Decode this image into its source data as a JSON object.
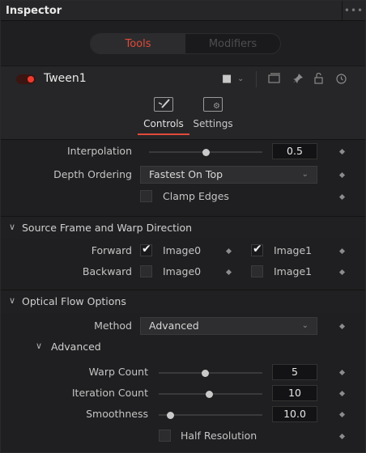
{
  "window": {
    "title": "Inspector",
    "menu_icon": "ellipsis-icon"
  },
  "segmented": {
    "tools": "Tools",
    "modifiers": "Modifiers",
    "selected": "Tools"
  },
  "node": {
    "name": "Tween1",
    "enabled": true
  },
  "tabs": [
    {
      "label": "Controls",
      "active": true
    },
    {
      "label": "Settings",
      "active": false
    }
  ],
  "controls": {
    "interpolation": {
      "label": "Interpolation",
      "value": "0.5",
      "fraction": 0.5
    },
    "depth_ordering": {
      "label": "Depth Ordering",
      "value": "Fastest On Top"
    },
    "clamp_edges": {
      "label": "Clamp Edges",
      "checked": false
    }
  },
  "source_frame": {
    "title": "Source Frame and Warp Direction",
    "forward": {
      "label": "Forward",
      "image0": {
        "label": "Image0",
        "checked": true
      },
      "image1": {
        "label": "Image1",
        "checked": true
      }
    },
    "backward": {
      "label": "Backward",
      "image0": {
        "label": "Image0",
        "checked": false
      },
      "image1": {
        "label": "Image1",
        "checked": false
      }
    }
  },
  "optical_flow": {
    "title": "Optical Flow Options",
    "method": {
      "label": "Method",
      "value": "Advanced"
    },
    "advanced": {
      "title": "Advanced",
      "warp_count": {
        "label": "Warp Count",
        "value": "5",
        "fraction": 0.45
      },
      "iteration_count": {
        "label": "Iteration Count",
        "value": "10",
        "fraction": 0.5
      },
      "smoothness": {
        "label": "Smoothness",
        "value": "10.0",
        "fraction": 0.08
      },
      "half_resolution": {
        "label": "Half Resolution",
        "checked": false
      }
    }
  }
}
